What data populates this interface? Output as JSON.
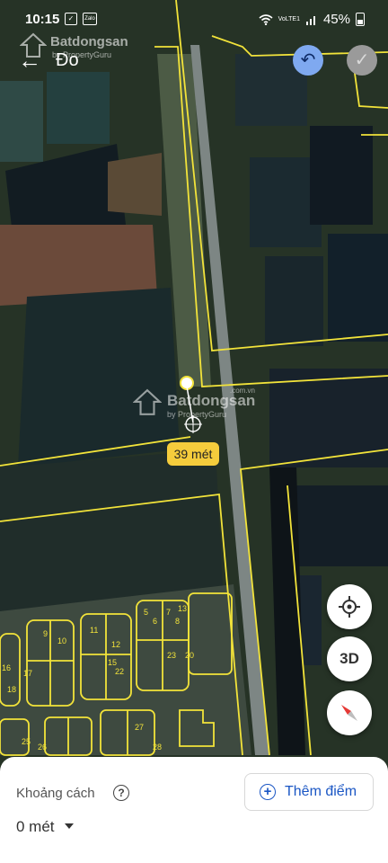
{
  "status_bar": {
    "time": "10:15",
    "notif_1": "✓",
    "notif_2": "Zalo",
    "network": "VoLTE1",
    "battery": "45%"
  },
  "top_bar": {
    "title": "Đo"
  },
  "watermark": {
    "name": "Batdongsan",
    "sub": "by PropertyGuru",
    "domain": ".com.vn"
  },
  "measurement": {
    "label": "39 mét"
  },
  "panel": {
    "label": "Khoảng cách",
    "value": "0 mét",
    "add_button": "Thêm điểm"
  },
  "controls": {
    "three_d": "3D"
  },
  "icons": {
    "back": "back-arrow-icon",
    "undo": "undo-icon",
    "confirm": "check-icon",
    "location": "my-location-icon",
    "compass": "compass-icon",
    "help": "help-icon",
    "add": "add-circle-icon"
  },
  "parcel_numbers": [
    "5",
    "6",
    "7",
    "8",
    "9",
    "10",
    "11",
    "12",
    "13",
    "15",
    "16",
    "17",
    "18",
    "20",
    "22",
    "23",
    "25",
    "26",
    "27",
    "28"
  ],
  "colors": {
    "parcel_line": "#f2e33a",
    "undo_bg": "#7fa9f0",
    "label_bg": "#f5cc3c",
    "link_blue": "#1a56c4"
  }
}
